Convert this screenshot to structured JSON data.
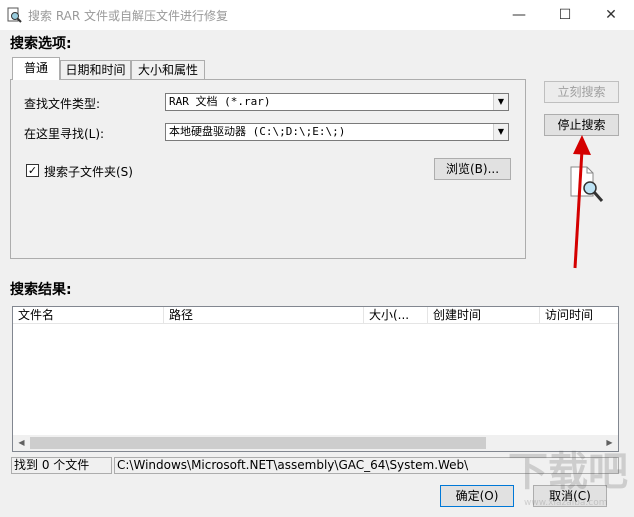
{
  "window": {
    "title": "搜索 RAR 文件或自解压文件进行修复",
    "minimize": "—",
    "maximize": "☐",
    "close": "✕"
  },
  "search_options": {
    "heading": "搜索选项:",
    "tabs": [
      {
        "label": "普通"
      },
      {
        "label": "日期和时间"
      },
      {
        "label": "大小和属性"
      }
    ],
    "file_type_label": "查找文件类型:",
    "file_type_value": "RAR 文档 (*.rar)",
    "location_label": "在这里寻找(L):",
    "location_value": "本地硬盘驱动器 (C:\\;D:\\;E:\\;)",
    "subfolders_label": "搜索子文件夹(S)",
    "subfolders_checked": true,
    "browse_button": "浏览(B)..."
  },
  "actions": {
    "search_now": "立刻搜索",
    "stop_search": "停止搜索"
  },
  "results": {
    "heading": "搜索结果:",
    "columns": [
      "文件名",
      "路径",
      "大小(...",
      "创建时间",
      "访问时间"
    ]
  },
  "status": {
    "found": "找到 0 个文件",
    "current_path": "C:\\Windows\\Microsoft.NET\\assembly\\GAC_64\\System.Web\\"
  },
  "footer": {
    "ok_button": "确定(O)",
    "cancel_button": "取消(C)"
  },
  "watermark": {
    "logo": "下载吧",
    "url": "www.xiazaiba.com"
  },
  "colors": {
    "annotation_arrow": "#d40000",
    "focus_border": "#0078d7"
  }
}
